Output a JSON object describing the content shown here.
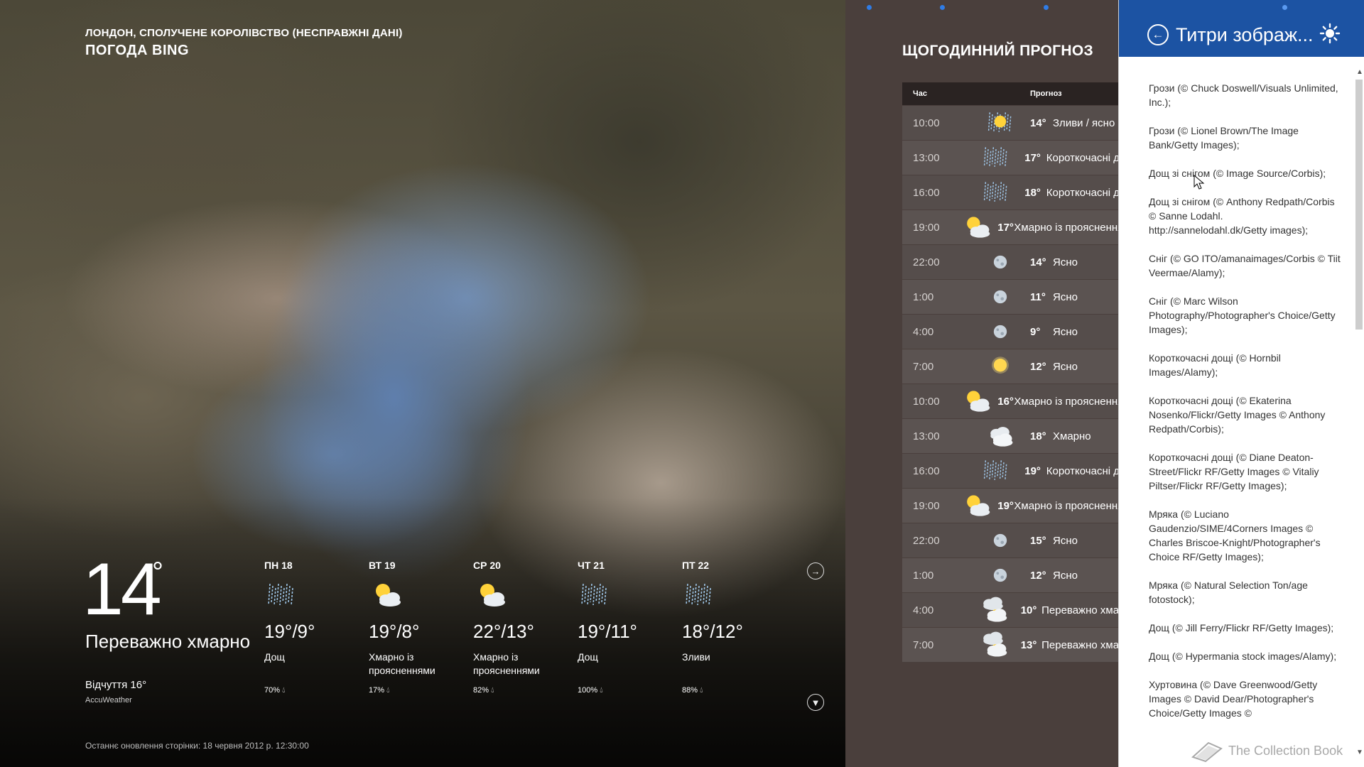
{
  "location": "ЛОНДОН, СПОЛУЧЕНЕ КОРОЛІВСТВО (НЕСПРАВЖНІ ДАНІ)",
  "app_title": "ПОГОДА BING",
  "current": {
    "temp": "14",
    "deg": "°",
    "condition": "Переважно хмарно",
    "feels_like": "Відчуття 16°",
    "provider": "AccuWeather",
    "updated": "Останнє оновлення сторінки: 18 червня 2012 р. 12:30:00"
  },
  "daily": [
    {
      "name": "ПН 18",
      "range": "19°/9°",
      "cond": "Дощ",
      "precip": "70%",
      "icon": "rain-icon"
    },
    {
      "name": "ВТ 19",
      "range": "19°/8°",
      "cond": "Хмарно із проясненнями",
      "precip": "17%",
      "icon": "partly-cloudy-icon"
    },
    {
      "name": "СР 20",
      "range": "22°/13°",
      "cond": "Хмарно із проясненнями",
      "precip": "82%",
      "icon": "partly-cloudy-icon"
    },
    {
      "name": "ЧТ 21",
      "range": "19°/11°",
      "cond": "Дощ",
      "precip": "100%",
      "icon": "rain-icon"
    },
    {
      "name": "ПТ 22",
      "range": "18°/12°",
      "cond": "Зливи",
      "precip": "88%",
      "icon": "rain-icon"
    }
  ],
  "hourly": {
    "title": "ЩОГОДИННИЙ ПРОГНОЗ",
    "col_time": "Час",
    "col_forecast": "Прогноз",
    "rows": [
      {
        "time": "10:00",
        "temp": "14°",
        "cond": "Зливи / ясно",
        "icon": "sun-rain-icon"
      },
      {
        "time": "13:00",
        "temp": "17°",
        "cond": "Короткочасні дощі",
        "icon": "rain-icon"
      },
      {
        "time": "16:00",
        "temp": "18°",
        "cond": "Короткочасні дощі",
        "icon": "rain-icon"
      },
      {
        "time": "19:00",
        "temp": "17°",
        "cond": "Хмарно із проясненнями",
        "icon": "partly-cloudy-icon"
      },
      {
        "time": "22:00",
        "temp": "14°",
        "cond": "Ясно",
        "icon": "moon-icon"
      },
      {
        "time": "1:00",
        "temp": "11°",
        "cond": "Ясно",
        "icon": "moon-icon"
      },
      {
        "time": "4:00",
        "temp": "9°",
        "cond": "Ясно",
        "icon": "moon-icon"
      },
      {
        "time": "7:00",
        "temp": "12°",
        "cond": "Ясно",
        "icon": "sun-icon"
      },
      {
        "time": "10:00",
        "temp": "16°",
        "cond": "Хмарно із проясненнями",
        "icon": "partly-cloudy-icon"
      },
      {
        "time": "13:00",
        "temp": "18°",
        "cond": "Хмарно",
        "icon": "cloud-icon"
      },
      {
        "time": "16:00",
        "temp": "19°",
        "cond": "Короткочасні дощі",
        "icon": "rain-icon"
      },
      {
        "time": "19:00",
        "temp": "19°",
        "cond": "Хмарно із проясненнями",
        "icon": "partly-cloudy-icon"
      },
      {
        "time": "22:00",
        "temp": "15°",
        "cond": "Ясно",
        "icon": "moon-icon"
      },
      {
        "time": "1:00",
        "temp": "12°",
        "cond": "Ясно",
        "icon": "moon-icon"
      },
      {
        "time": "4:00",
        "temp": "10°",
        "cond": "Переважно хмарно",
        "icon": "cloudy-sun-icon"
      },
      {
        "time": "7:00",
        "temp": "13°",
        "cond": "Переважно хмарно",
        "icon": "cloudy-sun-icon"
      }
    ]
  },
  "panel": {
    "title": "Титри зображ...",
    "credits": [
      "Грози (© Chuck Doswell/Visuals Unlimited, Inc.);",
      "Грози (© Lionel Brown/The Image Bank/Getty Images);",
      "Дощ зі снігом (© Image Source/Corbis);",
      "Дощ зі снігом (© Anthony Redpath/Corbis © Sanne Lodahl. http://sannelodahl.dk/Getty images);",
      "Сніг (© GO ITO/amanaimages/Corbis © Tiit Veermae/Alamy);",
      "Сніг (© Marc Wilson Photography/Photographer's Choice/Getty Images);",
      "Короткочасні дощі (© Hornbil Images/Alamy);",
      "Короткочасні дощі (© Ekaterina Nosenko/Flickr/Getty Images © Anthony Redpath/Corbis);",
      "Короткочасні дощі (© Diane Deaton-Street/Flickr RF/Getty Images © Vitaliy Piltser/Flickr RF/Getty Images);",
      "Мряка (© Luciano Gaudenzio/SIME/4Corners Images © Charles Briscoe-Knight/Photographer's Choice RF/Getty Images);",
      "Мряка (© Natural Selection Ton/age fotostock);",
      "Дощ (© Jill Ferry/Flickr RF/Getty Images);",
      "Дощ (© Hypermania stock images/Alamy);",
      "Хуртовина (© Dave Greenwood/Getty Images © David Dear/Photographer's Choice/Getty Images ©"
    ],
    "watermark": "The Collection Book"
  },
  "colors": {
    "panel_header": "#1c53a3",
    "accent_dot": "#2f7ce6",
    "hourly_bg": "#4a3f3c"
  }
}
